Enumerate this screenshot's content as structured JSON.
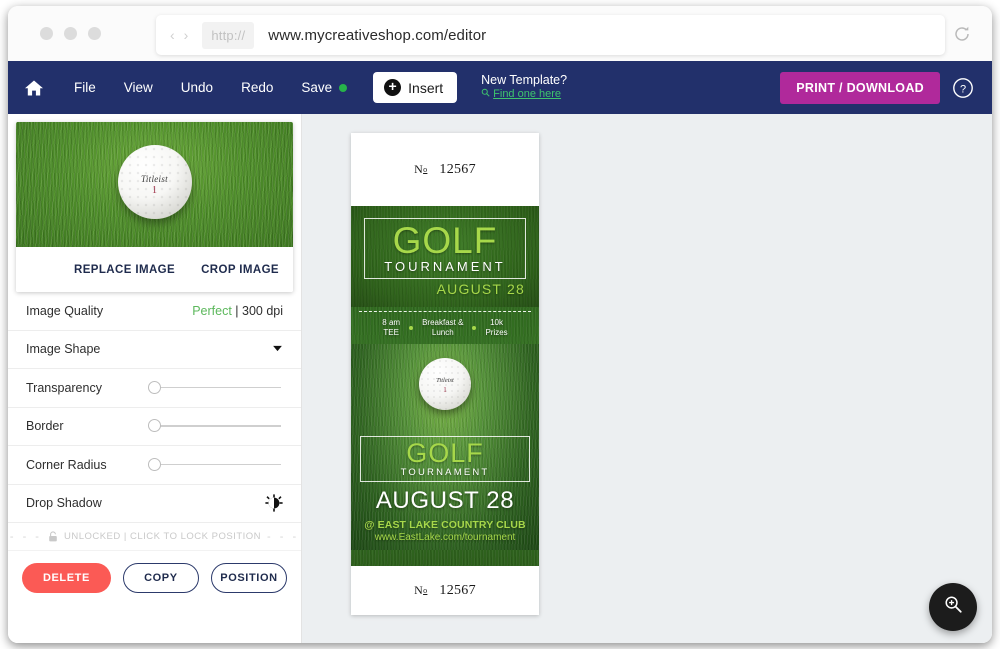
{
  "browser": {
    "protocol_chip": "http://",
    "url": "www.mycreativeshop.com/editor",
    "back_arrow": "‹",
    "forward_arrow": "›"
  },
  "navbar": {
    "home_label": "Home",
    "items": [
      {
        "label": "File"
      },
      {
        "label": "View"
      },
      {
        "label": "Undo"
      },
      {
        "label": "Redo"
      }
    ],
    "save_label": "Save",
    "save_status_color": "#27b34a",
    "insert_label": "Insert",
    "new_template_title": "New Template?",
    "new_template_link": "Find one here",
    "print_label": "PRINT / DOWNLOAD",
    "print_color": "#b0299b",
    "help_label": "Help"
  },
  "sidebar": {
    "image_card": {
      "replace_label": "REPLACE IMAGE",
      "crop_label": "CROP IMAGE",
      "ball_brand": "Titleist",
      "ball_number": "1"
    },
    "properties": [
      {
        "label": "Image Quality",
        "value_good": "Perfect",
        "value_rest": " | 300 dpi",
        "type": "text"
      },
      {
        "label": "Image Shape",
        "type": "dropdown"
      },
      {
        "label": "Transparency",
        "type": "slider",
        "position": 0
      },
      {
        "label": "Border",
        "type": "slider",
        "position": 0
      },
      {
        "label": "Corner Radius",
        "type": "slider",
        "position": 0
      },
      {
        "label": "Drop Shadow",
        "type": "toggle-icon"
      }
    ],
    "lock_bar": {
      "dashes_left": "- - -",
      "text": "UNLOCKED | CLICK TO LOCK POSITION",
      "dashes_right": "- - -"
    },
    "buttons": {
      "delete": "DELETE",
      "copy": "COPY",
      "position": "POSITION",
      "delete_color": "#fb5a55"
    }
  },
  "ticket": {
    "top_stub": {
      "numero": "N",
      "numero_sup": "o",
      "number": "12567"
    },
    "bottom_stub": {
      "numero": "N",
      "numero_sup": "o",
      "number": "12567"
    },
    "header": {
      "title": "GOLF",
      "subtitle": "TOURNAMENT",
      "date_small": "AUGUST 28"
    },
    "features": [
      {
        "line1": "8 am",
        "line2": "TEE"
      },
      {
        "line1": "Breakfast &",
        "line2": "Lunch"
      },
      {
        "line1": "10k",
        "line2": "Prizes"
      }
    ],
    "lower": {
      "title": "GOLF",
      "subtitle": "TOURNAMENT",
      "date_big": "AUGUST 28",
      "venue": "@ EAST LAKE COUNTRY CLUB",
      "website": "www.EastLake.com/tournament"
    },
    "accent_green": "#a7d84a",
    "ball_brand": "Titleist",
    "ball_number": "1"
  },
  "canvas": {
    "zoom_button_label": "Zoom in"
  }
}
